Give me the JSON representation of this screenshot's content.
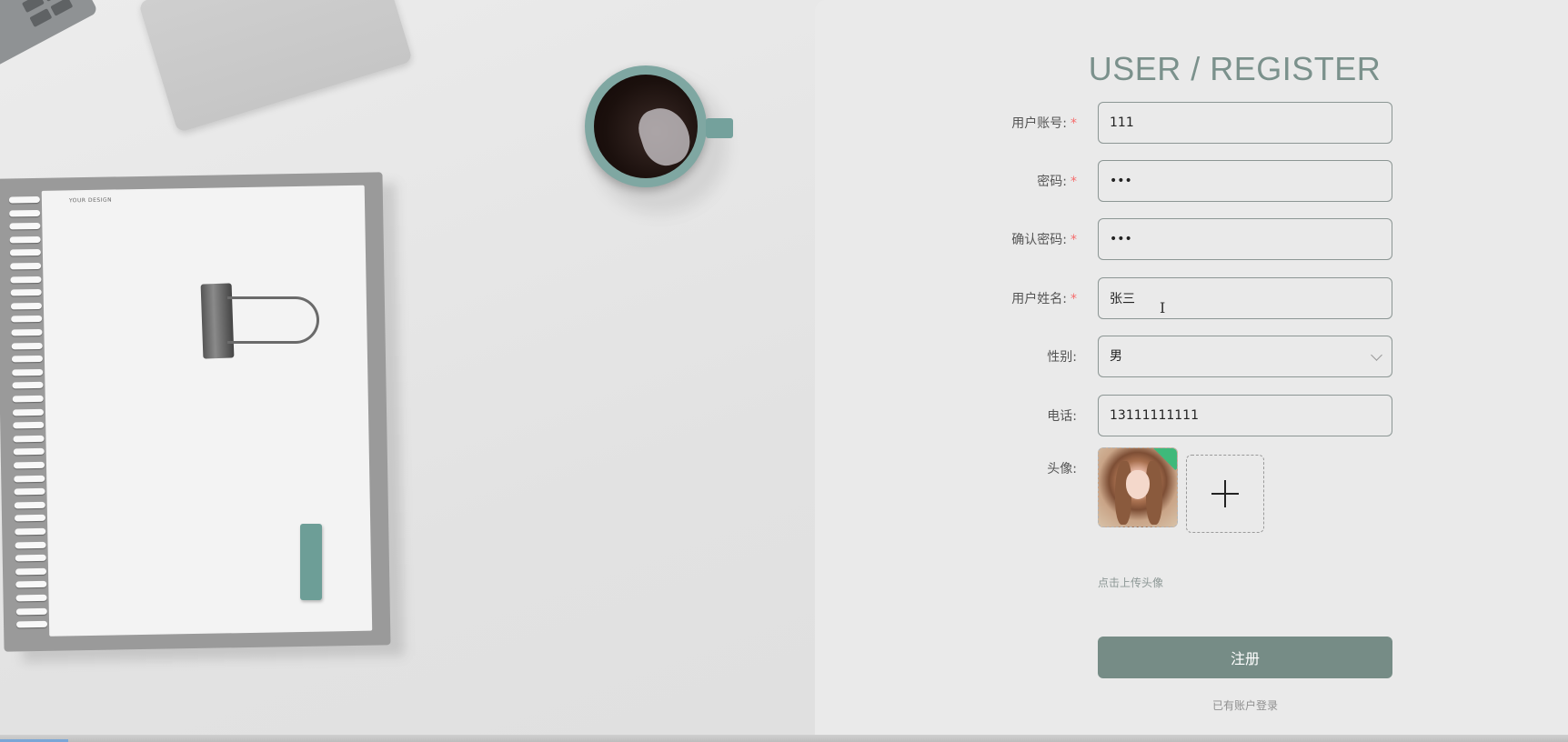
{
  "title": "USER / REGISTER",
  "required_mark": "*",
  "form": {
    "account": {
      "label": "用户账号:",
      "value": "111",
      "required": true
    },
    "password": {
      "label": "密码:",
      "value": "•••",
      "required": true
    },
    "confirm_password": {
      "label": "确认密码:",
      "value": "•••",
      "required": true
    },
    "name": {
      "label": "用户姓名:",
      "value": "张三",
      "required": true
    },
    "gender": {
      "label": "性别:",
      "value": "男",
      "required": false
    },
    "phone": {
      "label": "电话:",
      "value": "13111111111",
      "required": false
    },
    "avatar": {
      "label": "头像:",
      "hint": "点击上传头像"
    }
  },
  "submit_label": "注册",
  "login_link": "已有账户登录",
  "colors": {
    "accent": "#768c86",
    "title": "#7b918c",
    "required": "#f56c6c",
    "panel_bg": "#eaeaea"
  },
  "icons": {
    "upload": "plus-icon",
    "select": "chevron-down-icon",
    "text_cursor": "text-cursor-icon"
  }
}
